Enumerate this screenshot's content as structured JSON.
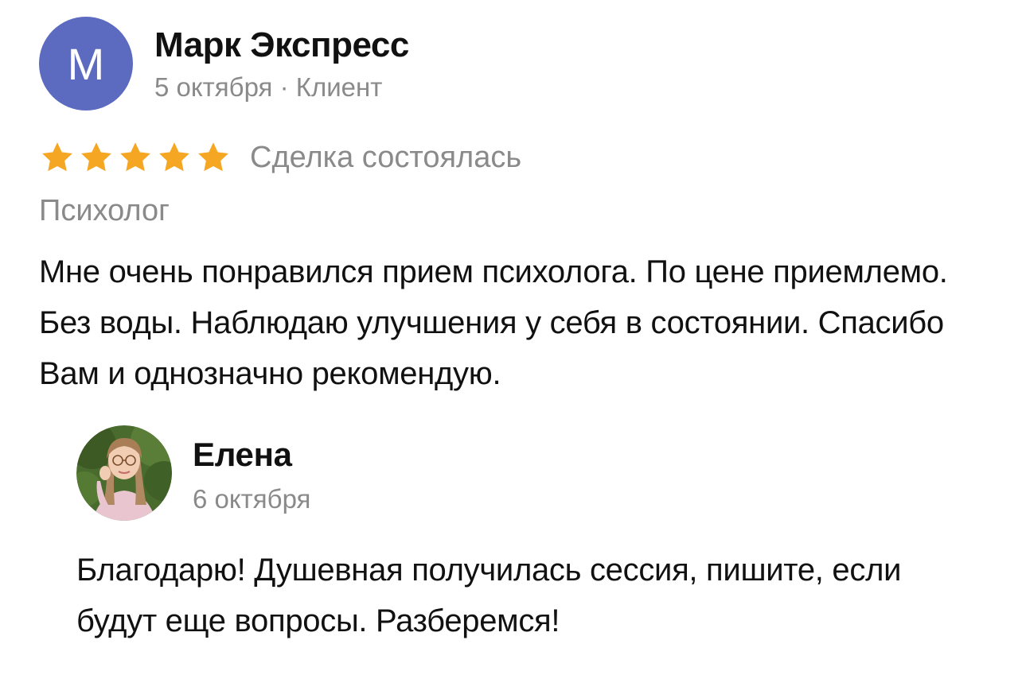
{
  "review": {
    "avatar_letter": "М",
    "avatar_color": "#5c6bc0",
    "author_name": "Марк Экспресс",
    "meta": "5 октября · Клиент",
    "rating": 5,
    "rating_max": 5,
    "star_color": "#f5a623",
    "deal_status": "Сделка состоялась",
    "category": "Психолог",
    "text": "Мне очень понравился прием психолога. По цене приемлемо. Без воды. Наблюдаю улучшения у себя в состоянии. Спасибо Вам и однозначно рекомендую."
  },
  "reply": {
    "avatar_icon": "user-photo-avatar",
    "author_name": "Елена",
    "date": "6 октября",
    "text": "Благодарю! Душевная получилась сессия, пишите, если будут еще вопросы. Разберемся!"
  }
}
